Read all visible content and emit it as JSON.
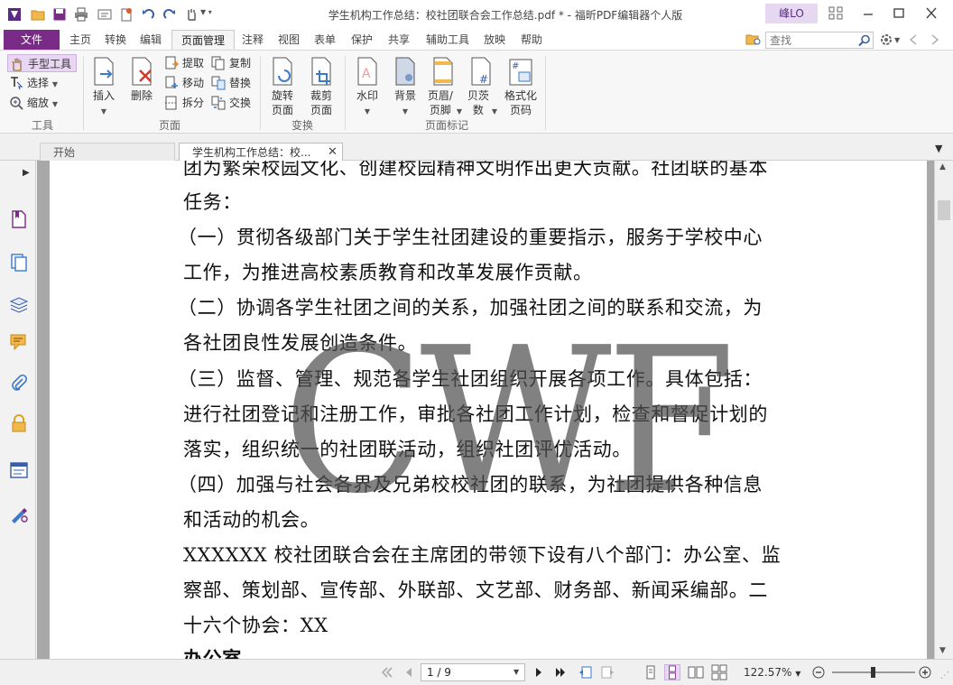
{
  "window": {
    "title": "学生机构工作总结：校社团联合会工作总结.pdf * - 福昕PDF编辑器个人版",
    "user": "峰LO"
  },
  "menu": {
    "file": "文件",
    "tabs": [
      "主页",
      "转换",
      "编辑",
      "页面管理",
      "注释",
      "视图",
      "表单",
      "保护",
      "共享",
      "辅助工具",
      "放映",
      "帮助"
    ],
    "active_tab": "页面管理",
    "search_placeholder": "查找"
  },
  "ribbon": {
    "tools": {
      "hand": "手型工具",
      "select": "选择",
      "zoom": "缩放",
      "group": "工具"
    },
    "page": {
      "insert": "插入",
      "delete": "删除",
      "extract": "提取",
      "move": "移动",
      "split": "拆分",
      "copy": "复制",
      "replace": "替换",
      "swap": "交换",
      "group": "页面"
    },
    "transform": {
      "rotate": "旋转页面",
      "crop": "裁剪页面",
      "group": "变换"
    },
    "marks": {
      "watermark": "水印",
      "background": "背景",
      "header_footer": "页眉/页脚",
      "bates": "贝茨数",
      "format_page": "格式化页码",
      "group": "页面标记"
    }
  },
  "doc_tabs": {
    "start": "开始",
    "current": "学生机构工作总结：校..."
  },
  "document": {
    "lines": [
      "团为繁荣校园文化、创建校园精神文明作出更大贡献。社团联的基本",
      "任务：",
      "（一）贯彻各级部门关于学生社团建设的重要指示，服务于学校中心",
      "工作，为推进高校素质教育和改革发展作贡献。",
      "（二）协调各学生社团之间的关系，加强社团之间的联系和交流，为",
      "各社团良性发展创造条件。",
      "（三）监督、管理、规范各学生社团组织开展各项工作。具体包括：",
      "进行社团登记和注册工作，审批各社团工作计划，检查和督促计划的",
      "落实，组织统一的社团联活动，组织社团评优活动。",
      "（四）加强与社会各界及兄弟校校社团的联系，为社团提供各种信息",
      "和活动的机会。",
      "XXXXXX 校社团联合会在主席团的带领下设有八个部门：办公室、监",
      "察部、策划部、宣传部、外联部、文艺部、财务部、新闻采编部。二",
      "十六个协会：XX",
      "办公室"
    ],
    "watermark": "CWF"
  },
  "status": {
    "page_indicator": "1 / 9",
    "zoom": "122.57%",
    "zoom_level": 0.49
  },
  "colors": {
    "accent": "#7a2b88",
    "highlight": "#e8d6f2"
  }
}
